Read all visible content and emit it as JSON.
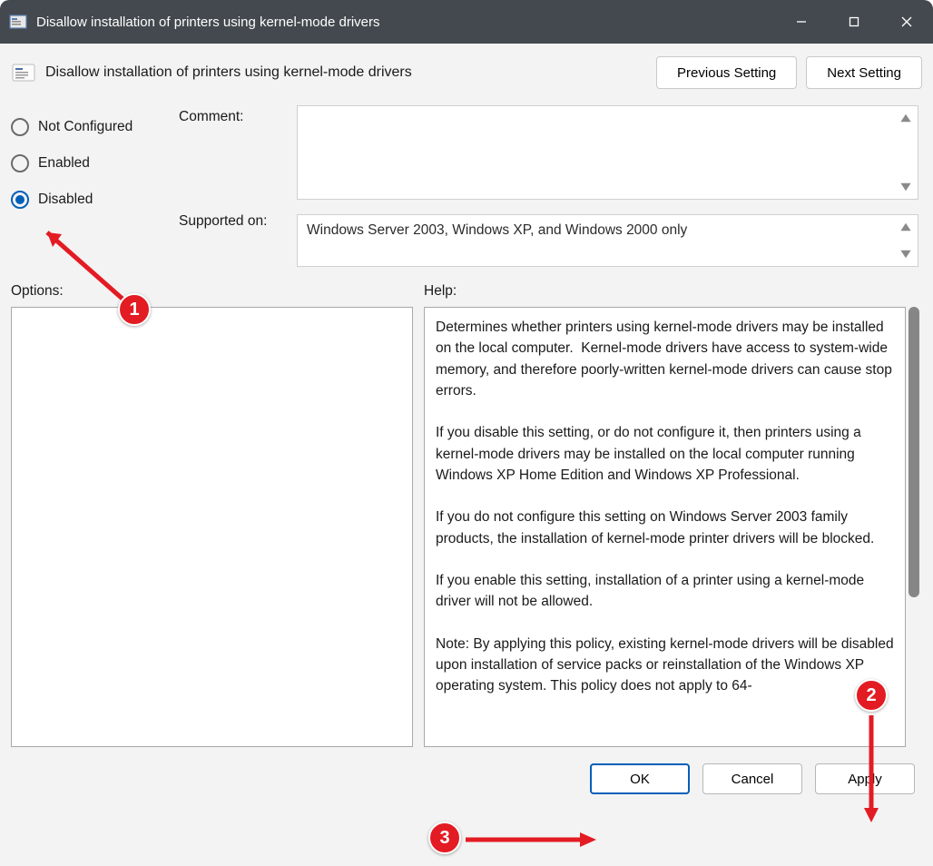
{
  "window": {
    "title": "Disallow installation of printers using kernel-mode drivers"
  },
  "header": {
    "policy_title": "Disallow installation of printers using kernel-mode drivers",
    "prev_btn": "Previous Setting",
    "next_btn": "Next Setting"
  },
  "radios": {
    "not_configured": "Not Configured",
    "enabled": "Enabled",
    "disabled": "Disabled",
    "selected": "disabled"
  },
  "labels": {
    "comment": "Comment:",
    "supported": "Supported on:",
    "options": "Options:",
    "help": "Help:"
  },
  "fields": {
    "comment_value": "",
    "supported_on": "Windows Server 2003, Windows XP, and Windows 2000 only"
  },
  "help_text": "Determines whether printers using kernel-mode drivers may be installed on the local computer.  Kernel-mode drivers have access to system-wide memory, and therefore poorly-written kernel-mode drivers can cause stop errors.\n\nIf you disable this setting, or do not configure it, then printers using a kernel-mode drivers may be installed on the local computer running Windows XP Home Edition and Windows XP Professional.\n\nIf you do not configure this setting on Windows Server 2003 family products, the installation of kernel-mode printer drivers will be blocked.\n\nIf you enable this setting, installation of a printer using a kernel-mode driver will not be allowed.\n\nNote: By applying this policy, existing kernel-mode drivers will be disabled upon installation of service packs or reinstallation of the Windows XP operating system. This policy does not apply to 64-",
  "footer": {
    "ok": "OK",
    "cancel": "Cancel",
    "apply": "Apply"
  },
  "annotations": {
    "b1": "1",
    "b2": "2",
    "b3": "3"
  }
}
